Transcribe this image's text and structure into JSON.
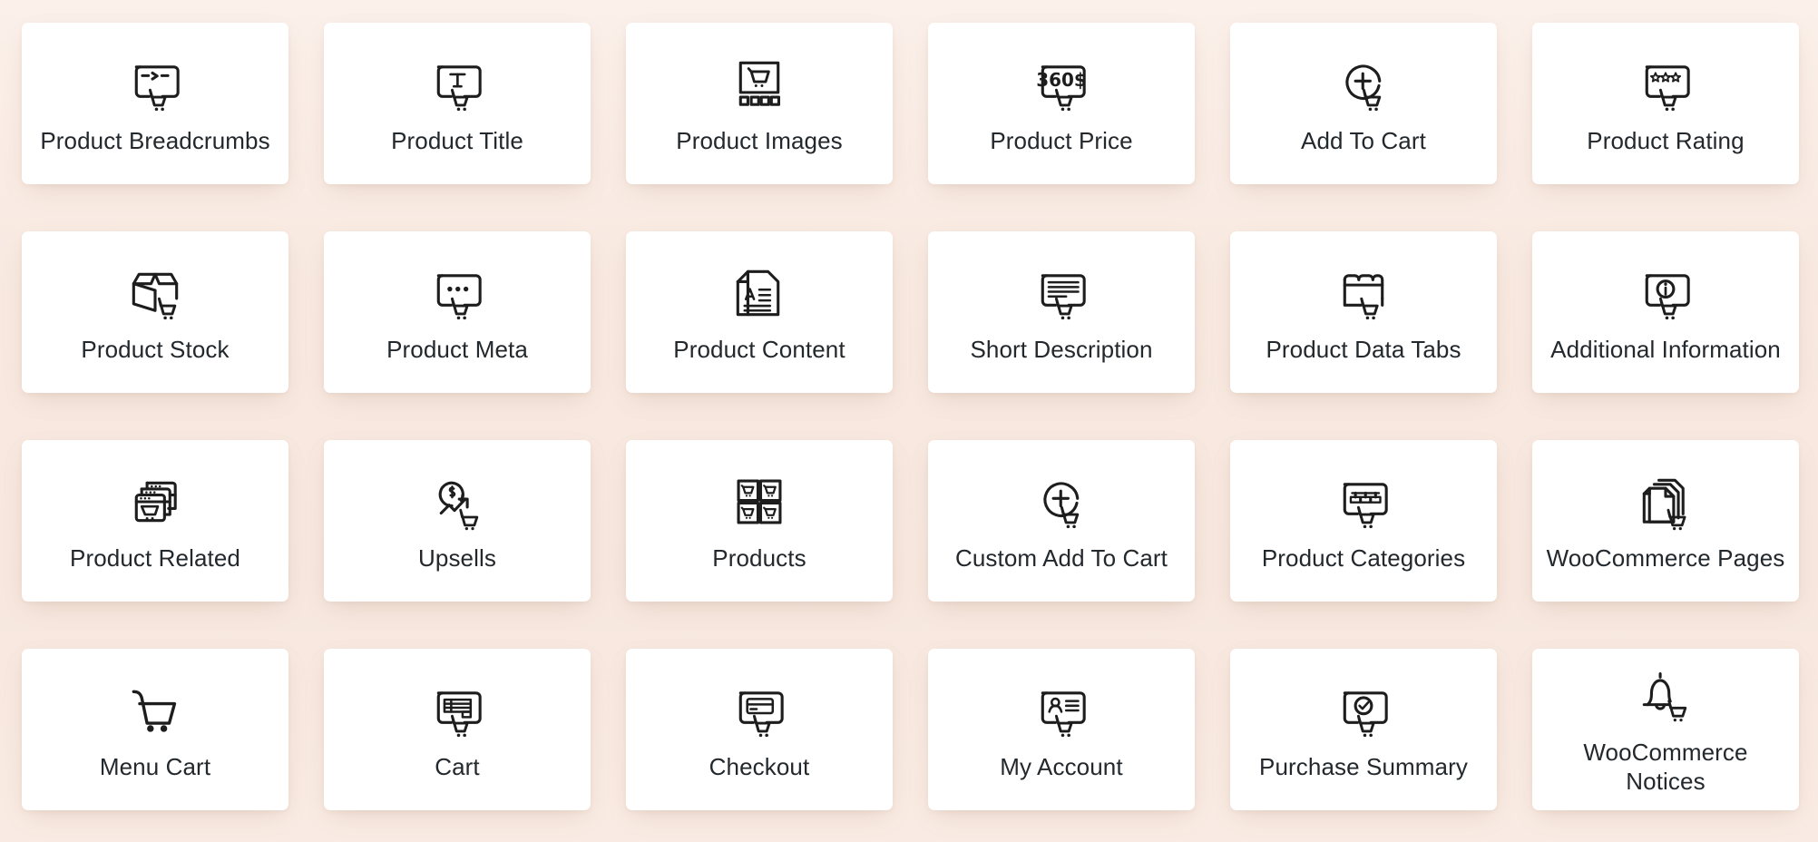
{
  "theme": {
    "background_color": "#f9ebe3",
    "card_color": "#ffffff",
    "icon_color": "#1d1d1d",
    "label_color": "#23282d"
  },
  "grid": {
    "columns": 6,
    "rows": 4
  },
  "cards": [
    {
      "label": "Product Breadcrumbs",
      "icon": "breadcrumbs-cart-icon"
    },
    {
      "label": "Product Title",
      "icon": "title-text-cart-icon"
    },
    {
      "label": "Product Images",
      "icon": "gallery-cart-icon"
    },
    {
      "label": "Product Price",
      "icon": "price-360-dollar-cart-icon"
    },
    {
      "label": "Add To Cart",
      "icon": "plus-circle-cart-icon"
    },
    {
      "label": "Product Rating",
      "icon": "stars-cart-icon"
    },
    {
      "label": "Product Stock",
      "icon": "open-box-cart-icon"
    },
    {
      "label": "Product Meta",
      "icon": "dots-cart-icon"
    },
    {
      "label": "Product Content",
      "icon": "document-a-lines-icon"
    },
    {
      "label": "Short Description",
      "icon": "text-lines-cart-icon"
    },
    {
      "label": "Product Data Tabs",
      "icon": "folder-tabs-cart-icon"
    },
    {
      "label": "Additional Information",
      "icon": "info-circle-cart-icon"
    },
    {
      "label": "Product Related",
      "icon": "stacked-windows-cart-icon"
    },
    {
      "label": "Upsells",
      "icon": "dollar-growth-arrow-cart-icon"
    },
    {
      "label": "Products",
      "icon": "four-cart-squares-icon"
    },
    {
      "label": "Custom Add To Cart",
      "icon": "plus-circle-cart-icon"
    },
    {
      "label": "Product Categories",
      "icon": "categories-tree-cart-icon"
    },
    {
      "label": "WooCommerce Pages",
      "icon": "stacked-pages-cart-icon"
    },
    {
      "label": "Menu Cart",
      "icon": "shopping-cart-icon"
    },
    {
      "label": "Cart",
      "icon": "cart-table-cart-icon"
    },
    {
      "label": "Checkout",
      "icon": "credit-card-cart-icon"
    },
    {
      "label": "My Account",
      "icon": "user-card-cart-icon"
    },
    {
      "label": "Purchase Summary",
      "icon": "check-circle-cart-icon"
    },
    {
      "label": "WooCommerce Notices",
      "icon": "bell-cart-icon"
    }
  ]
}
